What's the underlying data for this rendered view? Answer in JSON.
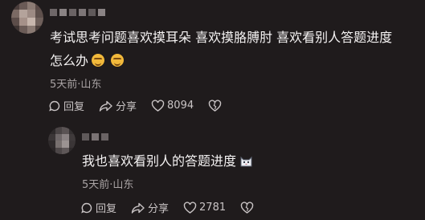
{
  "comments": [
    {
      "text": "考试思考问题喜欢摸耳朵 喜欢摸胳膊肘 喜欢看别人答题进度",
      "text_line2": "怎么办",
      "emojis": [
        "smirk-emoji",
        "smirk-emoji"
      ],
      "meta": "5天前·山东",
      "reply_label": "回复",
      "share_label": "分享",
      "like_count": "8094"
    },
    {
      "text": "我也喜欢看别人的答题进度",
      "emojis": [
        "cat-emoji"
      ],
      "meta": "5天前·山东",
      "reply_label": "回复",
      "share_label": "分享",
      "like_count": "2781"
    }
  ],
  "colors": {
    "background": "#1f1b1c",
    "text": "#f5f3f3",
    "meta": "#a9a3a4",
    "action": "#c9c4c5"
  }
}
